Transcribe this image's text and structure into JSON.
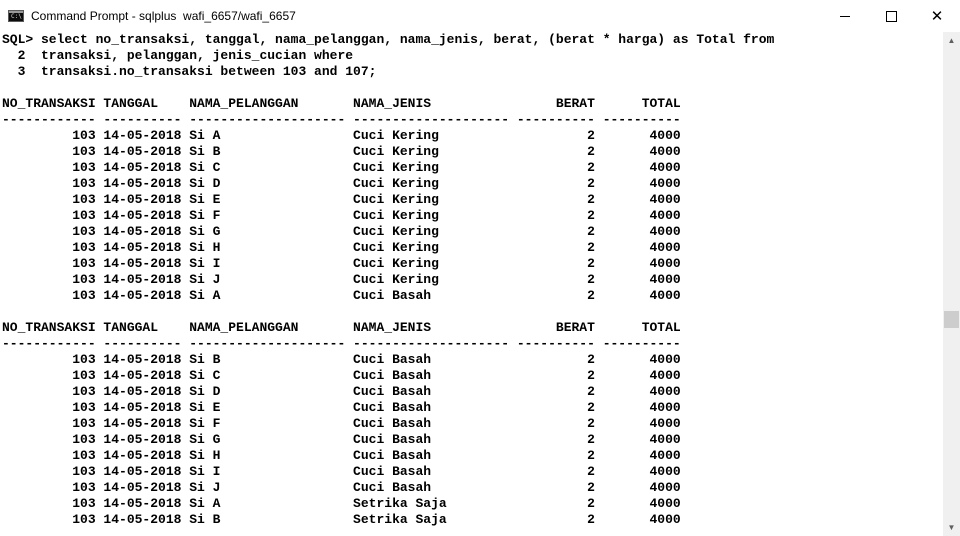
{
  "window": {
    "title": "Command Prompt - sqlplus  wafi_6657/wafi_6657",
    "minimize_label": "minimize",
    "maximize_label": "maximize",
    "close_label": "close"
  },
  "console": {
    "lines": [
      "SQL> select no_transaksi, tanggal, nama_pelanggan, nama_jenis, berat, (berat * harga) as Total from",
      "  2  transaksi, pelanggan, jenis_cucian where",
      "  3  transaksi.no_transaksi between 103 and 107;",
      "",
      "NO_TRANSAKSI TANGGAL    NAMA_PELANGGAN       NAMA_JENIS                BERAT      TOTAL",
      "------------ ---------- -------------------- -------------------- ---------- ----------",
      "         103 14-05-2018 Si A                 Cuci Kering                   2       4000",
      "         103 14-05-2018 Si B                 Cuci Kering                   2       4000",
      "         103 14-05-2018 Si C                 Cuci Kering                   2       4000",
      "         103 14-05-2018 Si D                 Cuci Kering                   2       4000",
      "         103 14-05-2018 Si E                 Cuci Kering                   2       4000",
      "         103 14-05-2018 Si F                 Cuci Kering                   2       4000",
      "         103 14-05-2018 Si G                 Cuci Kering                   2       4000",
      "         103 14-05-2018 Si H                 Cuci Kering                   2       4000",
      "         103 14-05-2018 Si I                 Cuci Kering                   2       4000",
      "         103 14-05-2018 Si J                 Cuci Kering                   2       4000",
      "         103 14-05-2018 Si A                 Cuci Basah                    2       4000",
      "",
      "NO_TRANSAKSI TANGGAL    NAMA_PELANGGAN       NAMA_JENIS                BERAT      TOTAL",
      "------------ ---------- -------------------- -------------------- ---------- ----------",
      "         103 14-05-2018 Si B                 Cuci Basah                    2       4000",
      "         103 14-05-2018 Si C                 Cuci Basah                    2       4000",
      "         103 14-05-2018 Si D                 Cuci Basah                    2       4000",
      "         103 14-05-2018 Si E                 Cuci Basah                    2       4000",
      "         103 14-05-2018 Si F                 Cuci Basah                    2       4000",
      "         103 14-05-2018 Si G                 Cuci Basah                    2       4000",
      "         103 14-05-2018 Si H                 Cuci Basah                    2       4000",
      "         103 14-05-2018 Si I                 Cuci Basah                    2       4000",
      "         103 14-05-2018 Si J                 Cuci Basah                    2       4000",
      "         103 14-05-2018 Si A                 Setrika Saja                  2       4000",
      "         103 14-05-2018 Si B                 Setrika Saja                  2       4000"
    ]
  }
}
